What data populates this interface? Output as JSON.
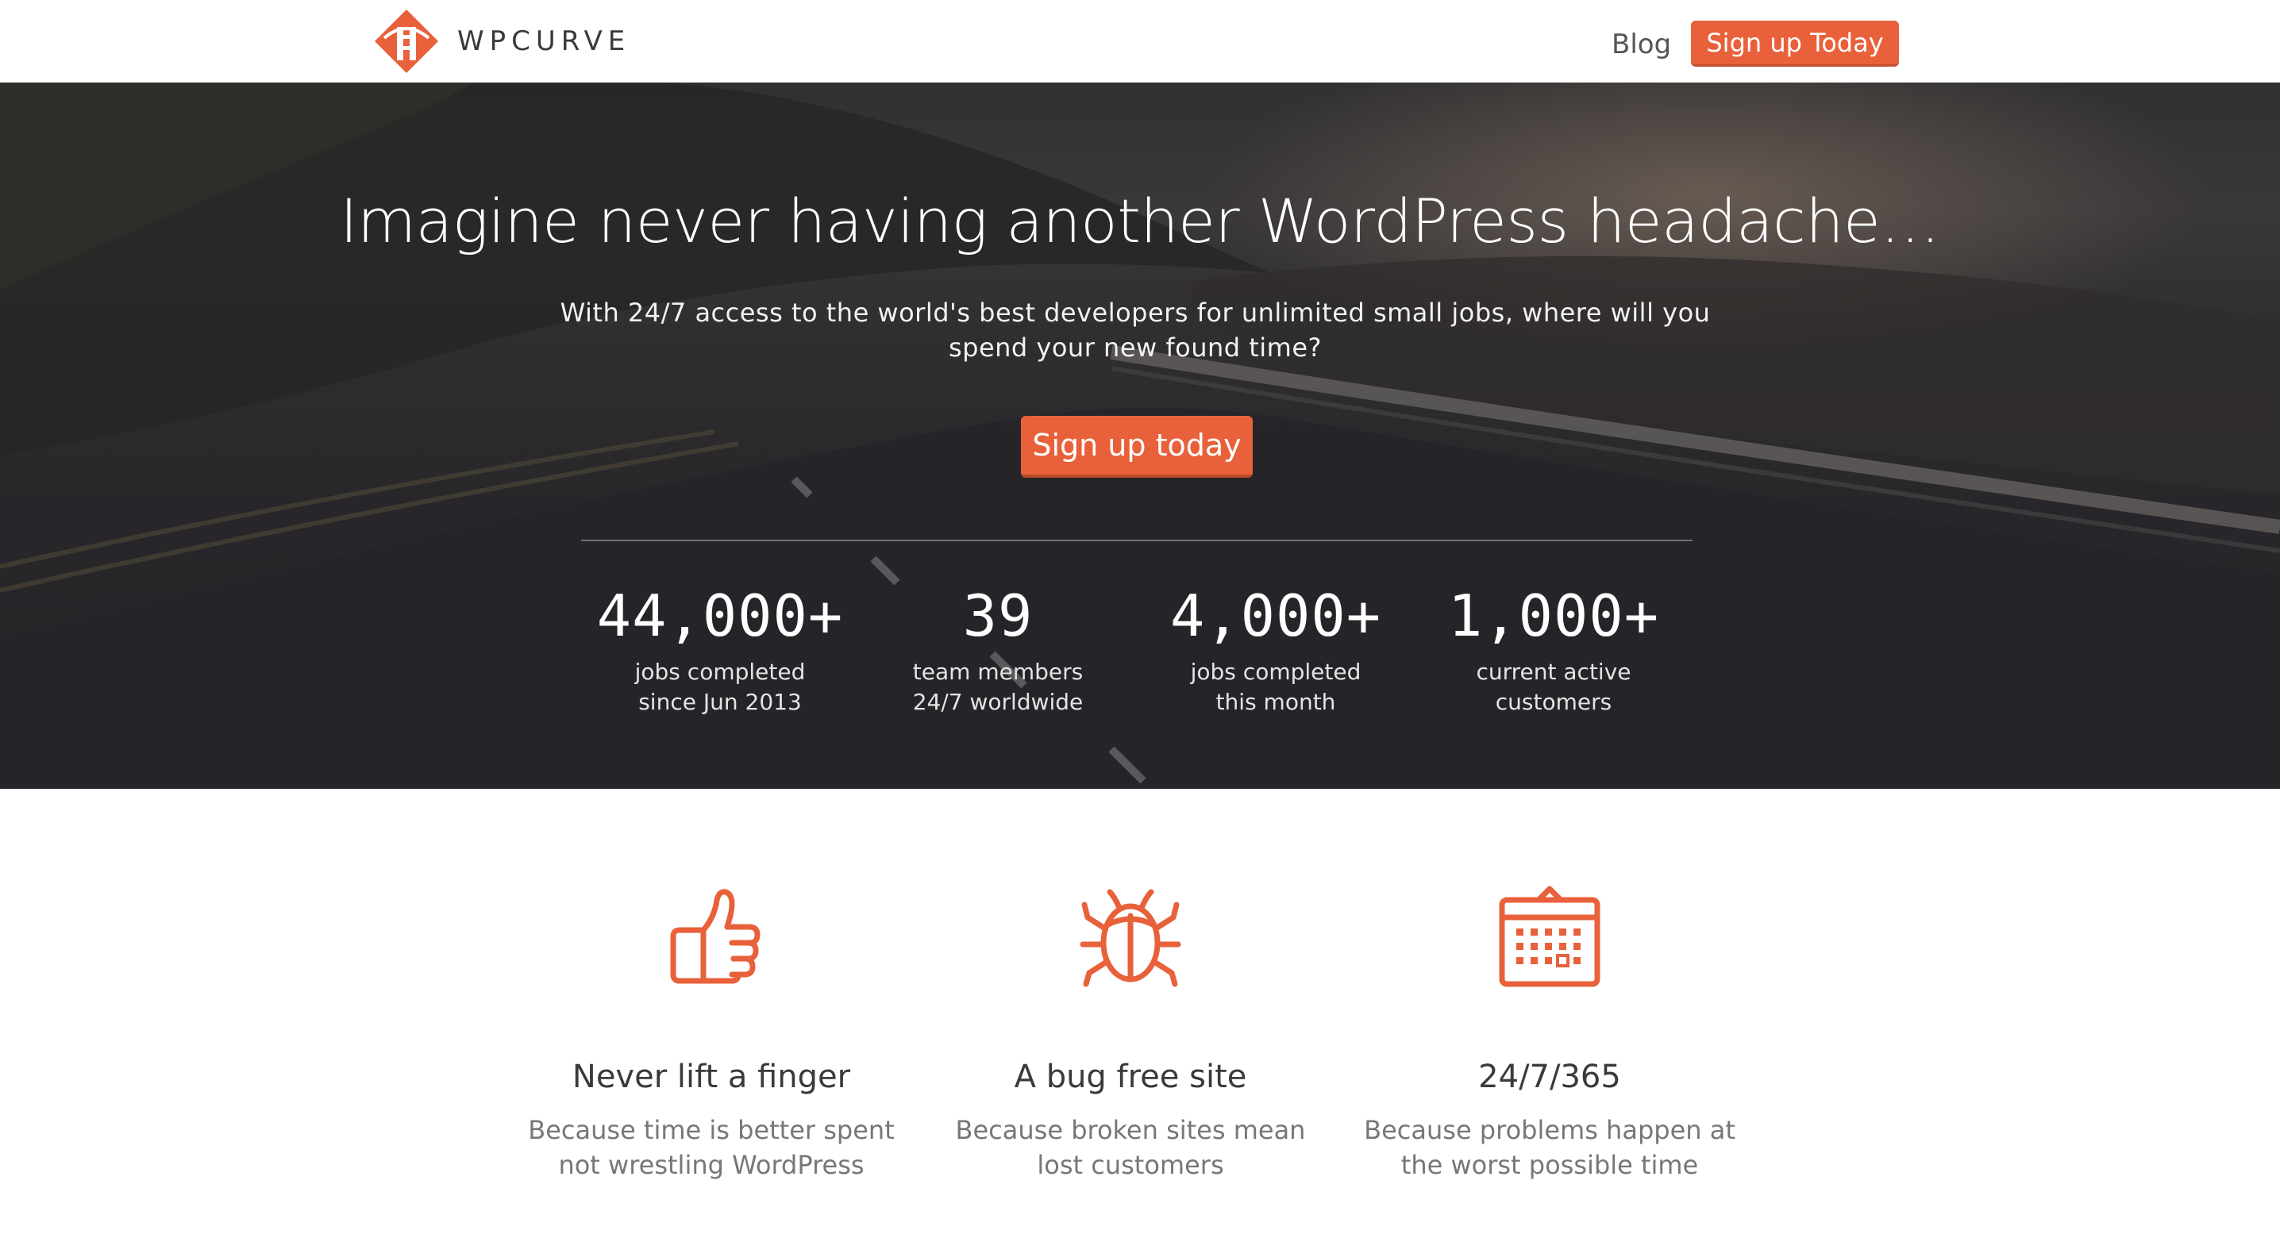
{
  "brand": {
    "name": "WPCURVE",
    "accent_color": "#e8613a"
  },
  "nav": {
    "blog_label": "Blog",
    "signup_label": "Sign up Today"
  },
  "hero": {
    "title": "Imagine never having another WordPress headache…",
    "subtitle": "With 24/7 access to the world's best developers for unlimited small jobs, where will you spend your new found time?",
    "cta_label": "Sign up today",
    "stats": [
      {
        "value": "44,000+",
        "line1": "jobs completed",
        "line2": "since Jun 2013"
      },
      {
        "value": "39",
        "line1": "team members",
        "line2": "24/7 worldwide"
      },
      {
        "value": "4,000+",
        "line1": "jobs completed",
        "line2": "this month"
      },
      {
        "value": "1,000+",
        "line1": "current active",
        "line2": "customers"
      }
    ]
  },
  "features": [
    {
      "icon": "thumbs-up-icon",
      "title": "Never lift a finger",
      "description": "Because time is better spent not wrestling WordPress"
    },
    {
      "icon": "bug-icon",
      "title": "A bug free site",
      "description": "Because broken sites mean lost customers"
    },
    {
      "icon": "calendar-icon",
      "title": "24/7/365",
      "description": "Because problems happen at the worst possible time"
    }
  ]
}
